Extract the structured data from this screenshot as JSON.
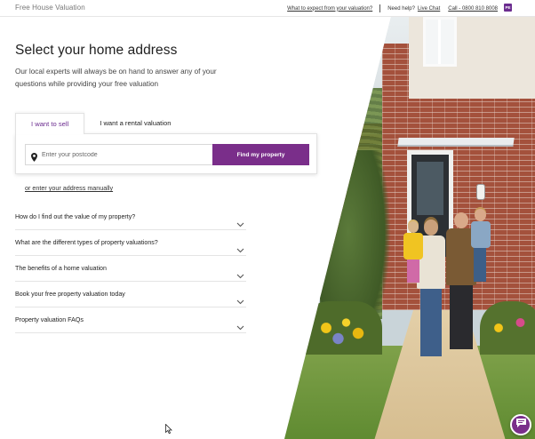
{
  "header": {
    "brand": "Free House Valuation",
    "link_expect": "What to expect from your valuation?",
    "need_help": "Need help?",
    "live_chat": "Live Chat",
    "call": "Call - 0800 810 8008",
    "badge": "PE"
  },
  "main": {
    "title": "Select your home address",
    "subtitle": "Our local experts will always be on hand to answer any of your questions while providing your free valuation",
    "tabs": [
      {
        "label": "I want to sell",
        "active": true
      },
      {
        "label": "I want a rental valuation",
        "active": false
      }
    ],
    "search": {
      "placeholder": "Enter your postcode",
      "value": "",
      "button": "Find my property"
    },
    "manual_link": "or enter your address manually",
    "faq": [
      "How do I find out the value of my property?",
      "What are the different types of property valuations?",
      "The benefits of a home valuation",
      "Book your free property valuation today",
      "Property valuation FAQs"
    ]
  },
  "colors": {
    "accent": "#7a2e8a",
    "tab_active_text": "#6b2c8f"
  },
  "icons": {
    "location": "map-pin-icon",
    "chevron": "chevron-down-icon",
    "chat": "chat-bubble-icon",
    "cursor": "mouse-pointer-icon"
  }
}
